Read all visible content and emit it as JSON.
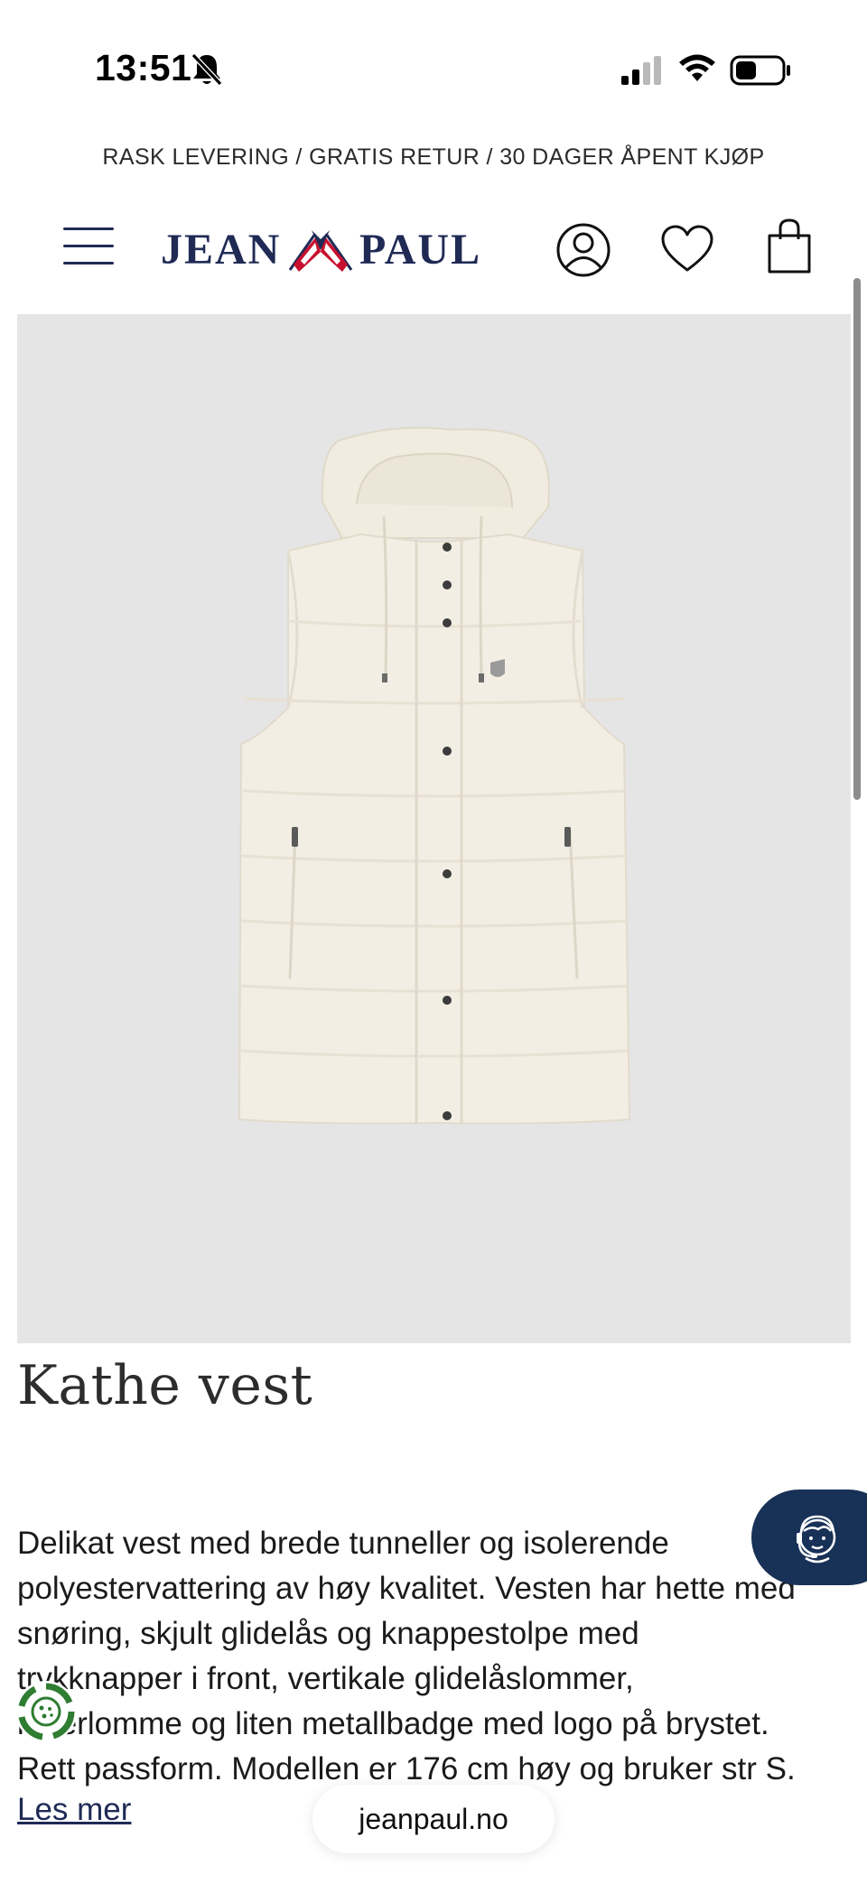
{
  "status_bar": {
    "time": "13:51",
    "icons": [
      "bell-muted-icon",
      "cellular-signal-icon",
      "wifi-icon",
      "battery-icon"
    ]
  },
  "promo": {
    "text": "RASK LEVERING / GRATIS RETUR / 30 DAGER ÅPENT KJØP"
  },
  "header": {
    "logo_left": "JEAN",
    "logo_right": "PAUL",
    "icons": [
      "menu-icon",
      "account-icon",
      "heart-icon",
      "shopping-bag-icon"
    ],
    "brand_color": "#1f2a55",
    "flag_colors": [
      "#c8102e",
      "#ffffff",
      "#1f2a55"
    ]
  },
  "product": {
    "title": "Kathe vest",
    "image_background": "#e5e5e6",
    "garment_color": "#f1ece0",
    "description_lines": [
      "Delikat vest med brede tunneller og isolerende",
      "polyestervattering av høy kvalitet. Vesten har hette med",
      "snøring, skjult glidelås og knappestolpe med",
      "trykknapper i front, vertikale glidelåslommer,",
      "innerlomme og liten metallbadge med logo på brystet.",
      "Rett passform. Modellen er 176 cm høy og bruker str S."
    ],
    "read_more": "Les mer"
  },
  "support": {
    "icon": "support-agent-icon",
    "color": "#173157"
  },
  "consent": {
    "icon": "cookie-consent-icon",
    "color": "#2f7d32"
  },
  "browser": {
    "url": "jeanpaul.no"
  }
}
